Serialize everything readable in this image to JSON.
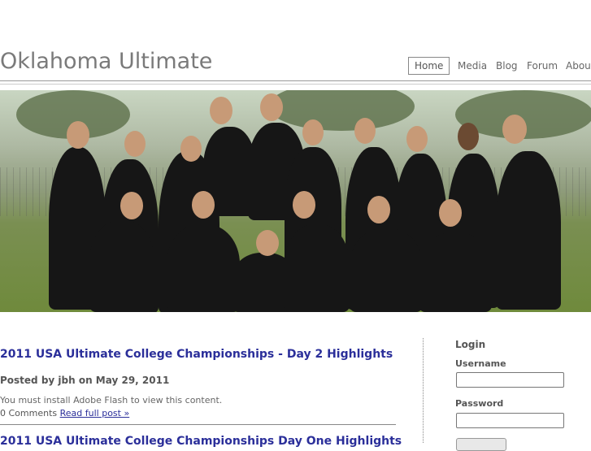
{
  "site": {
    "title": "Oklahoma Ultimate"
  },
  "nav": {
    "items": [
      {
        "label": "Home",
        "active": true
      },
      {
        "label": "Media"
      },
      {
        "label": "Blog"
      },
      {
        "label": "Forum"
      },
      {
        "label": "About"
      }
    ]
  },
  "banner": {
    "alt": "Team photo"
  },
  "posts": [
    {
      "title": "2011 USA Ultimate College Championships - Day 2 Highlights",
      "meta": "Posted by jbh on May 29, 2011",
      "body": "You must install Adobe Flash to view this content.",
      "comments": "0 Comments",
      "read_more": "Read full post »"
    },
    {
      "title": "2011 USA Ultimate College Championships Day One Highlights"
    }
  ],
  "login": {
    "title": "Login",
    "username_label": "Username",
    "password_label": "Password",
    "username_value": "",
    "password_value": ""
  },
  "colors": {
    "link": "#2b2f9a",
    "title": "#7a7a7a"
  }
}
